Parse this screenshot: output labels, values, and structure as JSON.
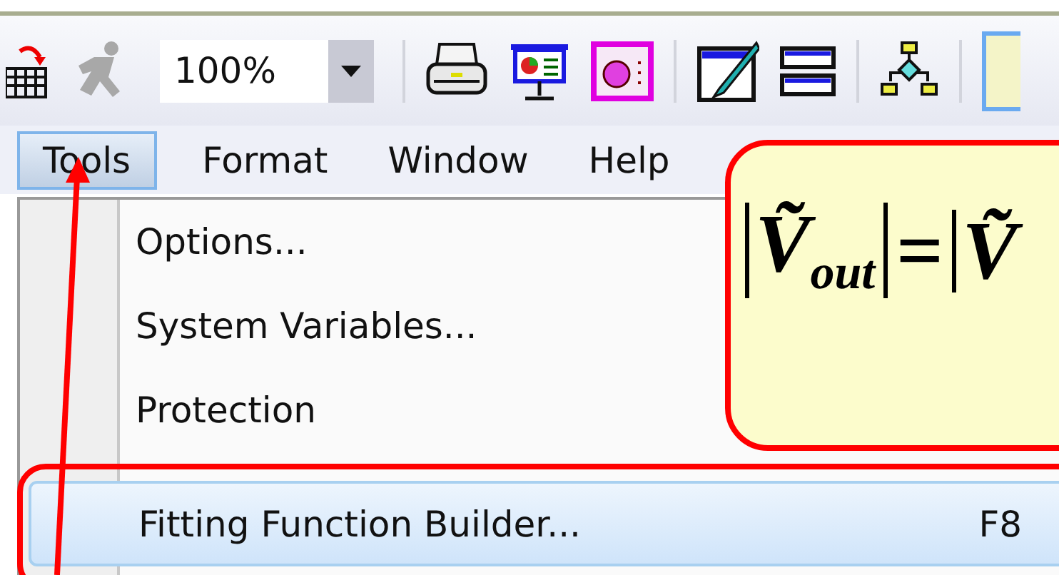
{
  "toolbar": {
    "buttons": [
      {
        "kind": "calculator",
        "disabled": false
      },
      {
        "kind": "runner",
        "disabled": true
      },
      {
        "kind": "zoom"
      },
      {
        "kind": "printer",
        "disabled": false
      },
      {
        "kind": "presentation",
        "disabled": false
      },
      {
        "kind": "media",
        "disabled": false
      },
      {
        "kind": "pen",
        "disabled": false
      },
      {
        "kind": "bars",
        "disabled": false
      },
      {
        "kind": "flowchart",
        "disabled": false
      },
      {
        "kind": "note",
        "disabled": false
      }
    ],
    "zoom": {
      "value": "100%"
    }
  },
  "menubar": [
    {
      "label": "Tools",
      "selected": true
    },
    {
      "label": "Format",
      "selected": false
    },
    {
      "label": "Window",
      "selected": false
    },
    {
      "label": "Help",
      "selected": false
    }
  ],
  "menu": {
    "items": [
      {
        "label": "Options...",
        "selected": false
      },
      {
        "label": "System Variables...",
        "selected": false
      },
      {
        "label": "Protection",
        "selected": false
      },
      {
        "label": "Fitting Function Builder...",
        "shortcut": "F8",
        "selected": true
      }
    ]
  },
  "callout": {
    "lhs_symbol": "Ṽ",
    "lhs_subscript": "out",
    "operator": "=",
    "rhs_symbol": "Ṽ"
  }
}
